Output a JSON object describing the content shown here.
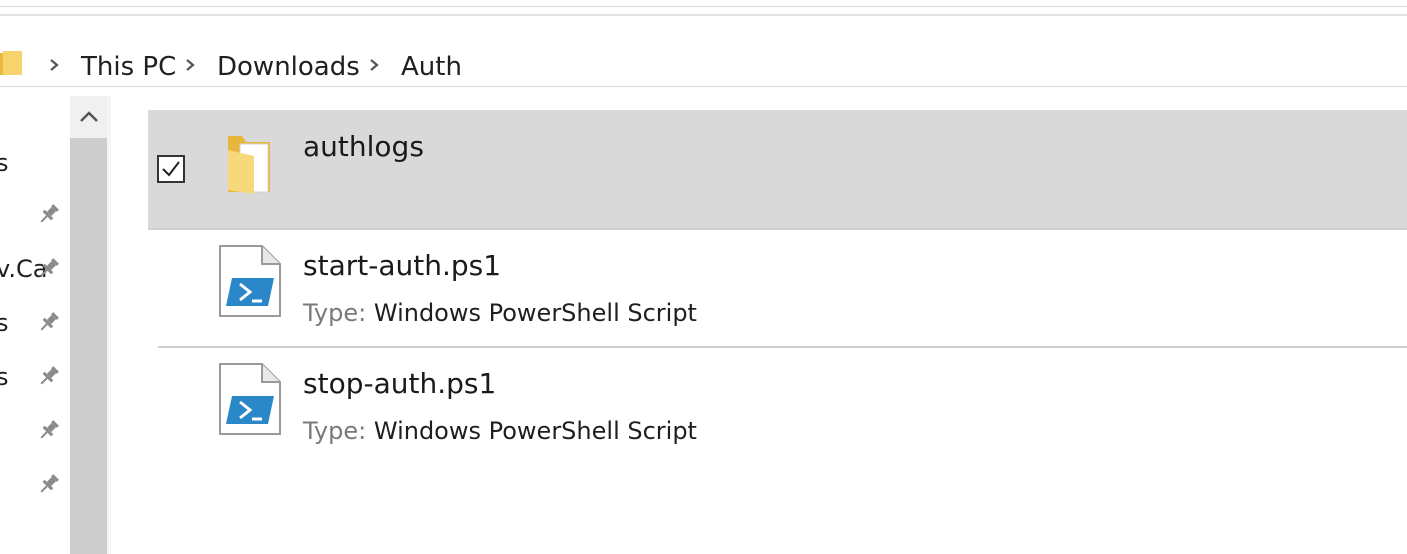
{
  "address_bar": {
    "breadcrumbs": [
      "This PC",
      "Downloads",
      "Auth"
    ]
  },
  "nav_pane": {
    "partial_items": [
      "s",
      "v.Ca",
      "s",
      "s"
    ]
  },
  "files": [
    {
      "name": "authlogs",
      "kind": "folder",
      "selected": true,
      "checked": true
    },
    {
      "name": "start-auth.ps1",
      "type_label": "Type:",
      "type_value": "Windows PowerShell Script"
    },
    {
      "name": "stop-auth.ps1",
      "type_label": "Type:",
      "type_value": "Windows PowerShell Script"
    }
  ],
  "colors": {
    "selected_row": "#d9d9d9",
    "folder_yellow": "#f5d46a",
    "powershell_blue": "#2a87c8"
  },
  "icons": [
    "folder-icon",
    "chevron-right-icon",
    "pin-icon",
    "chevron-up-icon",
    "checkbox-checked-icon",
    "powershell-script-icon"
  ]
}
